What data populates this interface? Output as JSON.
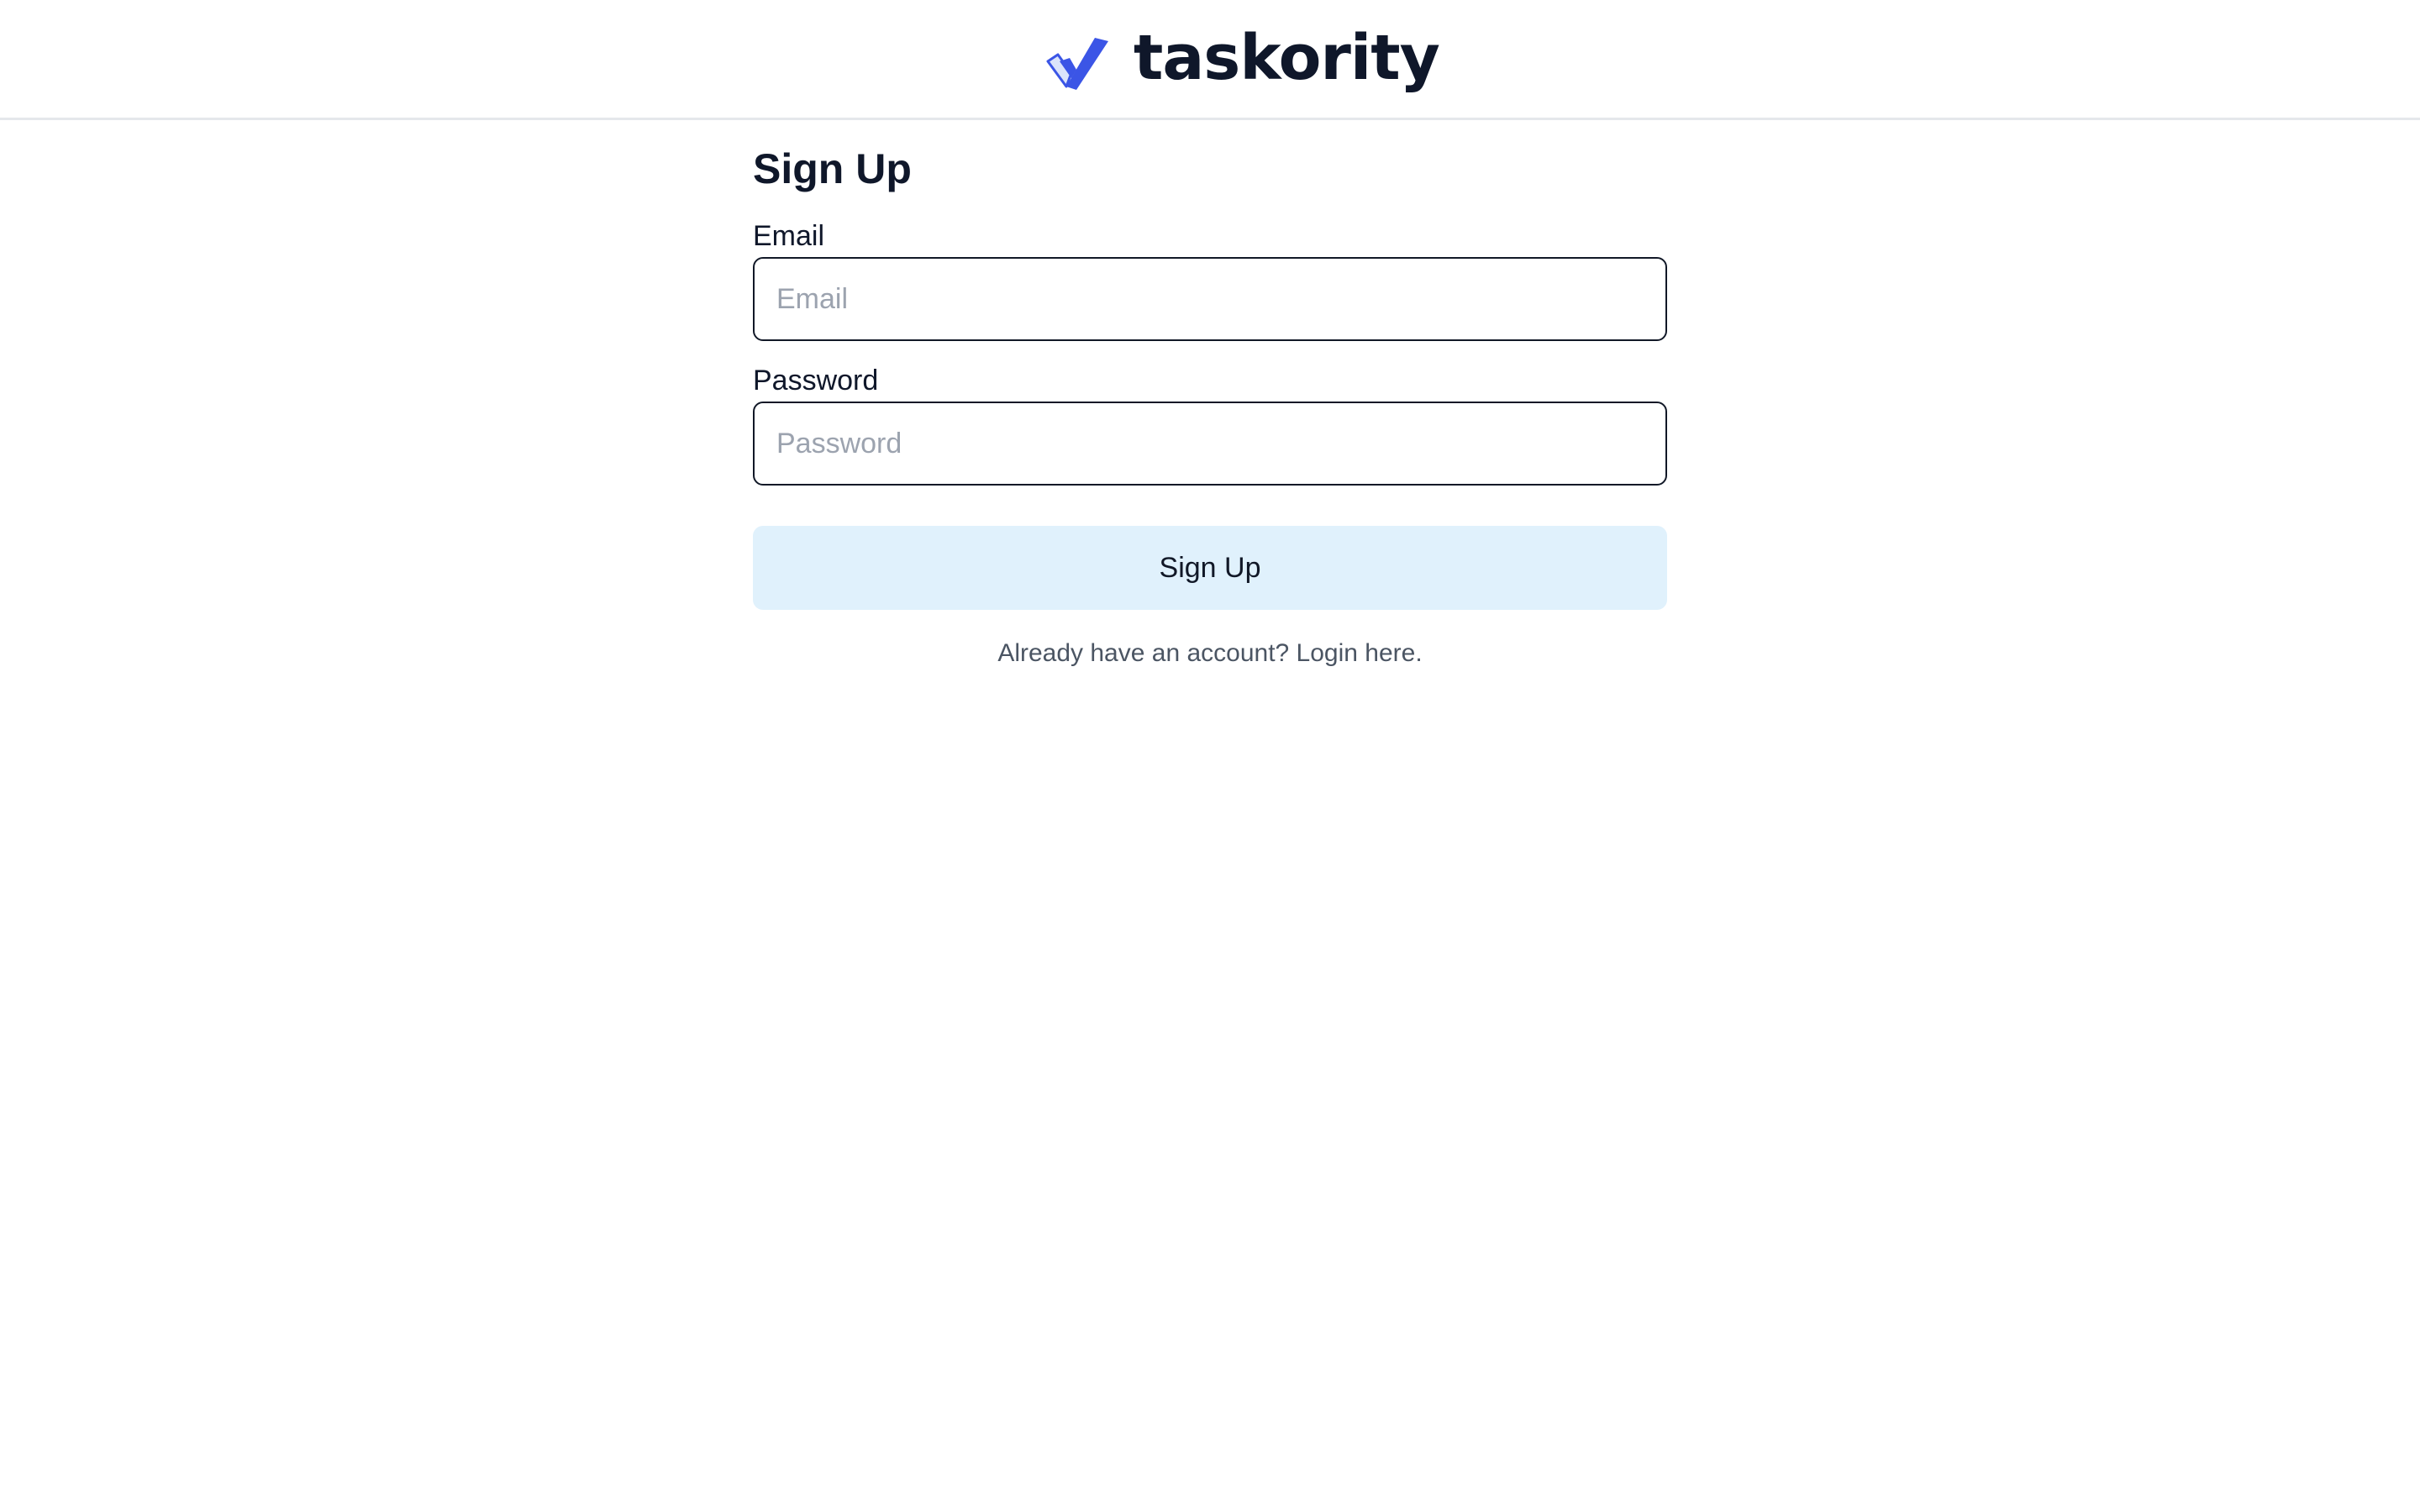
{
  "header": {
    "brand_name": "taskority",
    "logo_icon": "check-icon",
    "colors": {
      "logo_primary": "#3b55e6",
      "logo_light": "#dbe4fb",
      "text": "#0f172a"
    }
  },
  "form": {
    "title": "Sign Up",
    "email": {
      "label": "Email",
      "placeholder": "Email",
      "value": ""
    },
    "password": {
      "label": "Password",
      "placeholder": "Password",
      "value": ""
    },
    "submit_label": "Sign Up",
    "login_prompt": "Already have an account? Login here.",
    "colors": {
      "button_bg": "#e0f1fc",
      "input_border": "#111827",
      "muted_text": "#4b5563"
    }
  }
}
